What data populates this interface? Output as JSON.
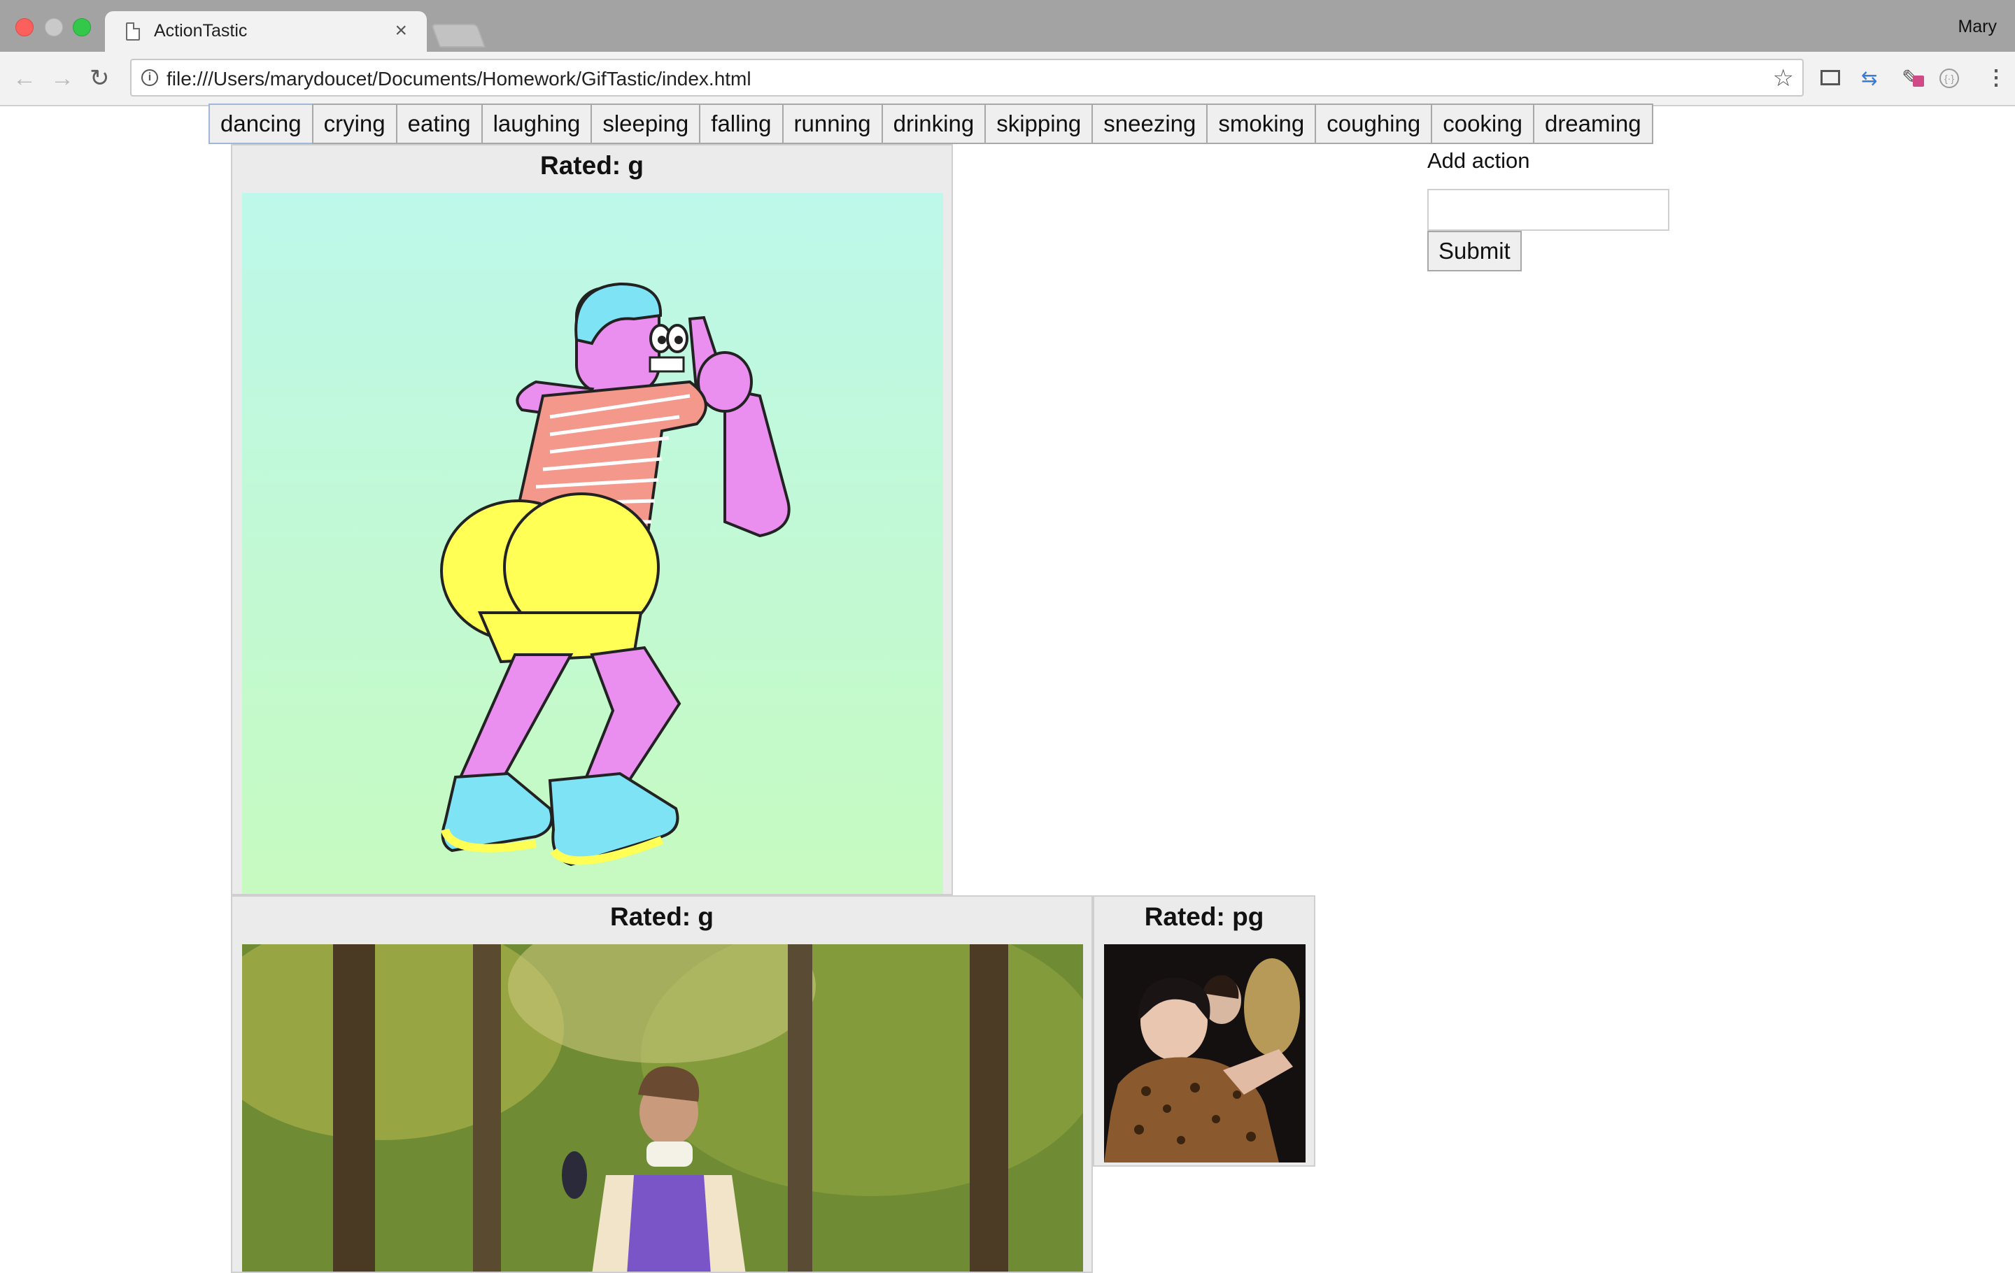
{
  "browser": {
    "tab_title": "ActionTastic",
    "tab_close": "×",
    "profile_name": "Mary",
    "url": "file:///Users/marydoucet/Documents/Homework/GifTastic/index.html",
    "icons": {
      "back": "←",
      "forward": "→",
      "reload": "↻",
      "info": "i",
      "star": "☆",
      "sync": "⇆",
      "dropper": "✎",
      "ext": "{·}",
      "menu": "⋮"
    }
  },
  "actions": [
    "dancing",
    "crying",
    "eating",
    "laughing",
    "sleeping",
    "falling",
    "running",
    "drinking",
    "skipping",
    "sneezing",
    "smoking",
    "coughing",
    "cooking",
    "dreaming"
  ],
  "form": {
    "label": "Add action",
    "input_value": "",
    "submit_label": "Submit"
  },
  "gifs": [
    {
      "rating": "Rated: g",
      "subject": "cartoon-dancer"
    },
    {
      "rating": "Rated: g",
      "subject": "forest-dancer"
    },
    {
      "rating": "Rated: pg",
      "subject": "audience-dancers"
    }
  ]
}
